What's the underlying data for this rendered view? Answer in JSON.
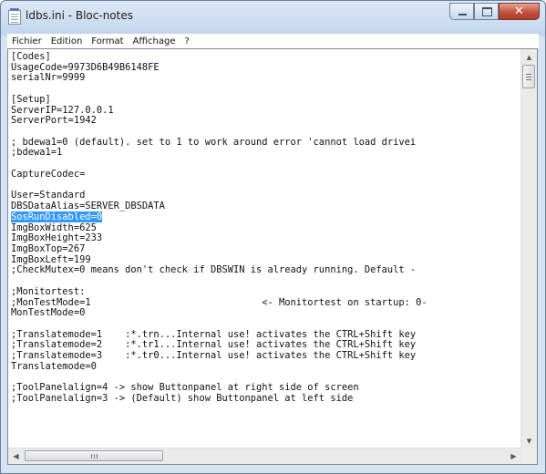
{
  "window": {
    "title": "ldbs.ini - Bloc-notes",
    "icons": {
      "app": "notepad-icon",
      "minimize": "minimize-icon",
      "maximize": "maximize-icon",
      "close": "close-icon"
    },
    "close_glyph": "✕"
  },
  "menu": [
    "Fichier",
    "Edition",
    "Format",
    "Affichage",
    "?"
  ],
  "editor": {
    "lines": [
      "[Codes]",
      "UsageCode=9973D6B49B6148FE",
      "serialNr=9999",
      "",
      "[Setup]",
      "ServerIP=127.0.0.1",
      "ServerPort=1942",
      "",
      "; bdewa1=0 (default). set to 1 to work around error 'cannot load drivei",
      ";bdewa1=1",
      "",
      "CaptureCodec=",
      "",
      "User=Standard",
      "DBSDataAlias=SERVER_DBSDATA",
      "SosRunDisabled=0",
      "ImgBoxWidth=625",
      "ImgBoxHeight=233",
      "ImgBoxTop=267",
      "ImgBoxLeft=199",
      ";CheckMutex=0 means don't check if DBSWIN is already running. Default -",
      "",
      ";Monitortest:",
      ";MonTestMode=1                              <- Monitortest on startup: 0-",
      "MonTestMode=0",
      "",
      ";Translatemode=1    :*.trn...Internal use! activates the CTRL+Shift key",
      ";Translatemode=2    :*.tr1...Internal use! activates the CTRL+Shift key",
      ";Translatemode=3    :*.tr0...Internal use! activates the CTRL+Shift key",
      "Translatemode=0",
      "",
      ";ToolPanelalign=4 -> show Buttonpanel at right side of screen",
      ";ToolPanelalign=3 -> (Default) show Buttonpanel at left side",
      "",
      "",
      ""
    ],
    "selected_line_index": 15,
    "selection_color": "#3399ff"
  },
  "scrollbars": {
    "up_arrow": "▲",
    "down_arrow": "▼",
    "left_arrow": "◀",
    "right_arrow": "▶",
    "vertical_position": 0.0,
    "horizontal_position": 0.0
  }
}
